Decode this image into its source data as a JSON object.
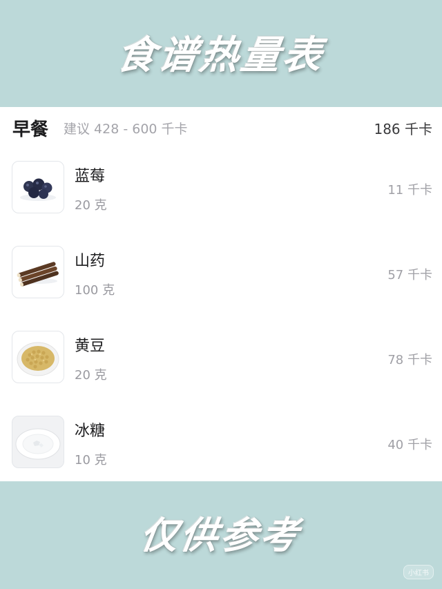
{
  "banner": {
    "top_title": "食谱热量表",
    "bottom_title": "仅供参考"
  },
  "meal": {
    "title": "早餐",
    "suggestion": "建议 428 - 600 千卡",
    "total": "186 千卡"
  },
  "foods": [
    {
      "name": "蓝莓",
      "qty": "20 克",
      "cal": "11 千卡",
      "icon": "blueberry-icon"
    },
    {
      "name": "山药",
      "qty": "100 克",
      "cal": "57 千卡",
      "icon": "yam-icon"
    },
    {
      "name": "黄豆",
      "qty": "20 克",
      "cal": "78 千卡",
      "icon": "soybean-icon"
    },
    {
      "name": "冰糖",
      "qty": "10 克",
      "cal": "40 千卡",
      "icon": "rock-sugar-icon"
    }
  ],
  "watermark": "小红书"
}
